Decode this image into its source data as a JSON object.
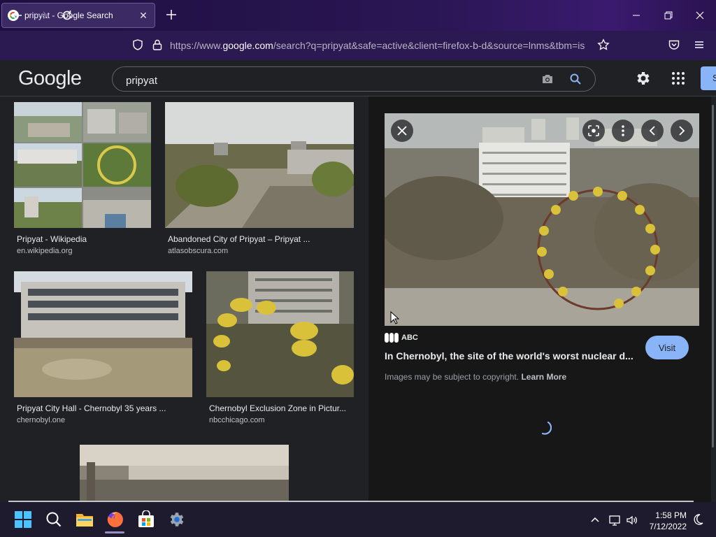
{
  "browser": {
    "tab": {
      "title": "pripyat - Google Search",
      "favicon": "google-g-icon",
      "close_icon": "close-icon"
    },
    "new_tab_icon": "plus-icon",
    "window_controls": [
      "minimize-icon",
      "restore-icon",
      "close-icon"
    ],
    "nav": {
      "back_icon": "arrow-left-icon",
      "forward_icon": "arrow-right-icon",
      "reload_icon": "reload-icon"
    },
    "url": {
      "prefix": "https://www.",
      "domain": "google.com",
      "rest": "/search?q=pripyat&safe=active&client=firefox-b-d&source=lnms&tbm=is"
    },
    "toolbar_icons": [
      "shield-icon",
      "lock-icon",
      "star-icon",
      "pocket-icon",
      "menu-icon"
    ]
  },
  "google": {
    "logo": "Google",
    "search_query": "pripyat",
    "icons": [
      "camera-icon",
      "search-icon",
      "settings-icon",
      "apps-icon"
    ],
    "signin_label": "S"
  },
  "results": [
    {
      "caption": "Pripyat - Wikipedia",
      "source": "en.wikipedia.org"
    },
    {
      "caption": "Abandoned City of Pripyat – Pripyat ...",
      "source": "atlasobscura.com"
    },
    {
      "caption": "Pripyat City Hall - Chernobyl 35 years ...",
      "source": "chernobyl.one"
    },
    {
      "caption": "Chernobyl Exclusion Zone in Pictur...",
      "source": "nbcchicago.com"
    }
  ],
  "preview": {
    "source_name": "ABC",
    "title": "In Chernobyl, the site of the world's worst nuclear d...",
    "copyright_text": "Images may be subject to copyright.",
    "learn_more": "Learn More",
    "visit_label": "Visit",
    "icons": [
      "close-icon",
      "lens-icon",
      "more-vert-icon",
      "chevron-left-icon",
      "chevron-right-icon"
    ]
  },
  "taskbar": {
    "icons": [
      "windows-start-icon",
      "search-icon",
      "file-explorer-icon",
      "firefox-icon",
      "store-icon",
      "settings-icon"
    ],
    "tray_icons": [
      "chevron-up-icon",
      "network-icon",
      "volume-icon",
      "moon-icon"
    ],
    "time": "1:58 PM",
    "date": "7/12/2022"
  }
}
